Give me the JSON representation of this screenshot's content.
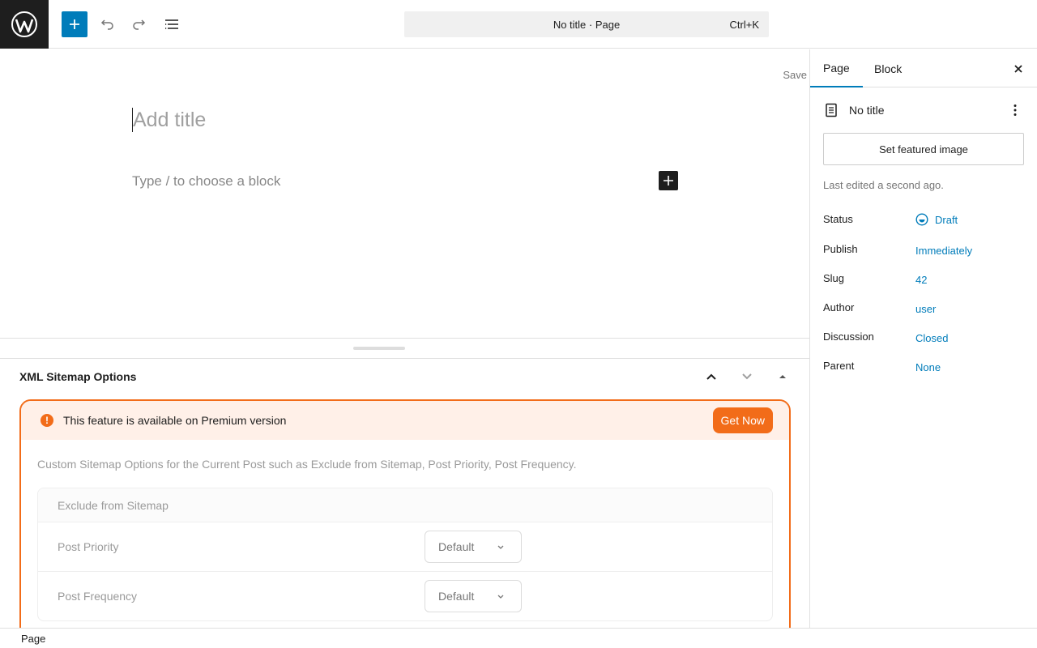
{
  "topbar": {
    "command_title": "No title · Page",
    "command_shortcut": "Ctrl+K"
  },
  "editor": {
    "save_label": "Save",
    "title_placeholder": "Add title",
    "block_placeholder": "Type / to choose a block"
  },
  "metabox": {
    "title": "XML Sitemap Options",
    "premium_notice": "This feature is available on Premium version",
    "get_now_label": "Get Now",
    "description": "Custom Sitemap Options for the Current Post such as Exclude from Sitemap, Post Priority, Post Frequency.",
    "options": [
      {
        "label": "Exclude from Sitemap",
        "value": ""
      },
      {
        "label": "Post Priority",
        "value": "Default"
      },
      {
        "label": "Post Frequency",
        "value": "Default"
      }
    ]
  },
  "statusbar": {
    "breadcrumb": "Page"
  },
  "sidebar": {
    "tabs": [
      "Page",
      "Block"
    ],
    "active_tab": "Page",
    "document_title": "No title",
    "featured_image_label": "Set featured image",
    "last_edited": "Last edited a second ago.",
    "meta": [
      {
        "key": "Status",
        "value": "Draft"
      },
      {
        "key": "Publish",
        "value": "Immediately"
      },
      {
        "key": "Slug",
        "value": "42"
      },
      {
        "key": "Author",
        "value": "user"
      },
      {
        "key": "Discussion",
        "value": "Closed"
      },
      {
        "key": "Parent",
        "value": "None"
      }
    ]
  },
  "colors": {
    "accent": "#007cba",
    "premium_orange": "#f26c19",
    "dark": "#1e1e1e"
  },
  "icons": [
    "wordpress-logo-icon",
    "plus-icon",
    "undo-icon",
    "redo-icon",
    "document-overview-icon",
    "block-plus-icon",
    "chevron-up-icon",
    "chevron-down-icon",
    "triangle-up-icon",
    "warning-icon",
    "page-icon",
    "kebab-icon",
    "close-icon",
    "draft-status-icon"
  ]
}
